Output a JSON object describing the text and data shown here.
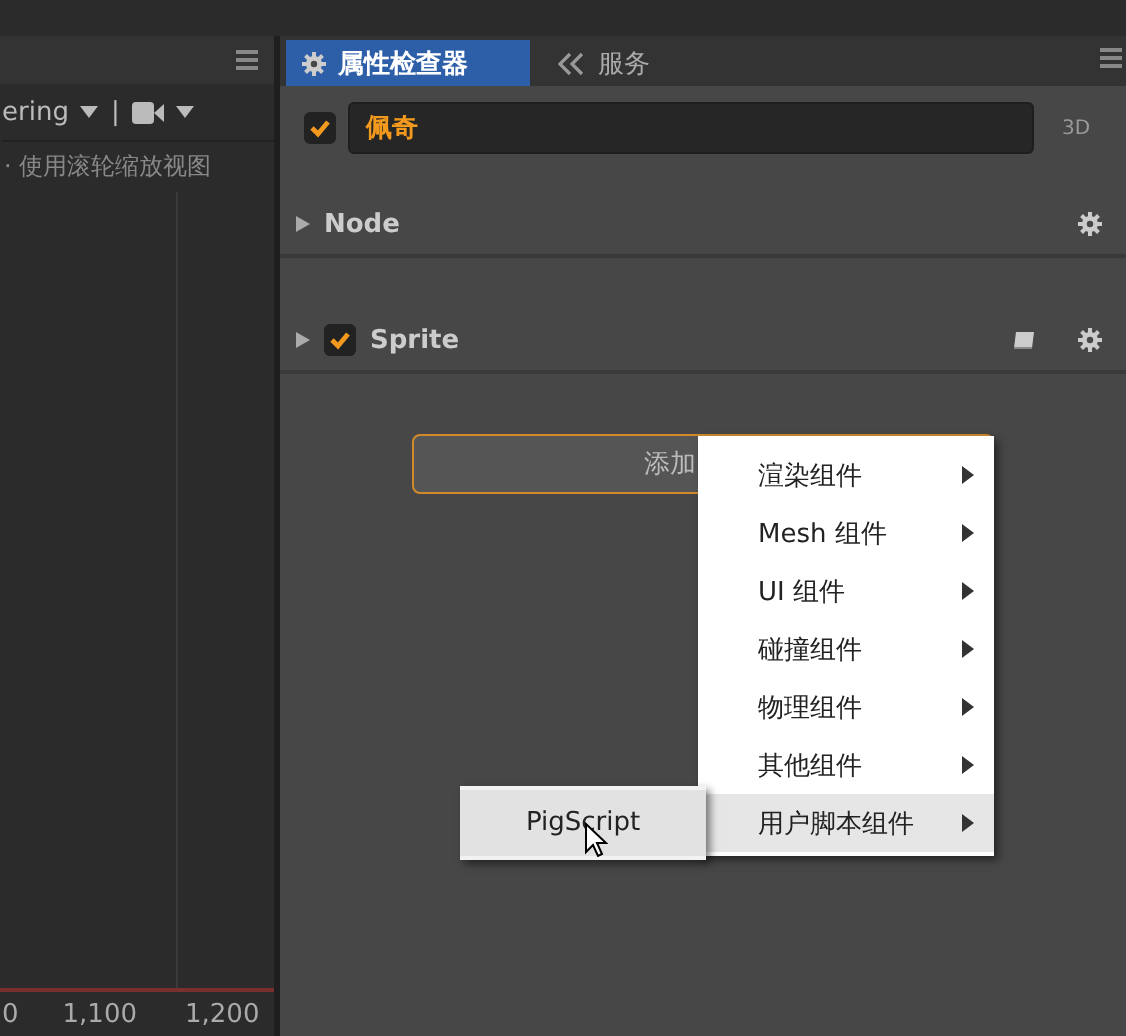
{
  "scene_panel": {
    "toolbar": {
      "mode": "ering",
      "separator": "|"
    },
    "hint": "· 使用滚轮缩放视图",
    "ruler_labels": [
      "0",
      "1,100",
      "1,200"
    ]
  },
  "inspector": {
    "tabs": [
      {
        "label": "属性检查器",
        "selected": true,
        "kind": "gear"
      },
      {
        "label": "服务",
        "selected": false,
        "kind": "service"
      }
    ],
    "node": {
      "checked": true,
      "name": "佩奇",
      "mode": "3D"
    },
    "components": [
      {
        "kind": "node",
        "name": "Node"
      },
      {
        "kind": "component",
        "name": "Sprite",
        "checked": true
      }
    ],
    "add_component_button": "添加"
  },
  "context_menu": {
    "items": [
      {
        "label": "渲染组件",
        "selected": false
      },
      {
        "label": "Mesh 组件",
        "selected": false
      },
      {
        "label": "UI 组件",
        "selected": false
      },
      {
        "label": "碰撞组件",
        "selected": false
      },
      {
        "label": "物理组件",
        "selected": false
      },
      {
        "label": "其他组件",
        "selected": false
      },
      {
        "label": "用户脚本组件",
        "selected": true
      }
    ],
    "submenu": {
      "items": [
        {
          "label": "PigScript",
          "selected": true
        }
      ]
    }
  }
}
